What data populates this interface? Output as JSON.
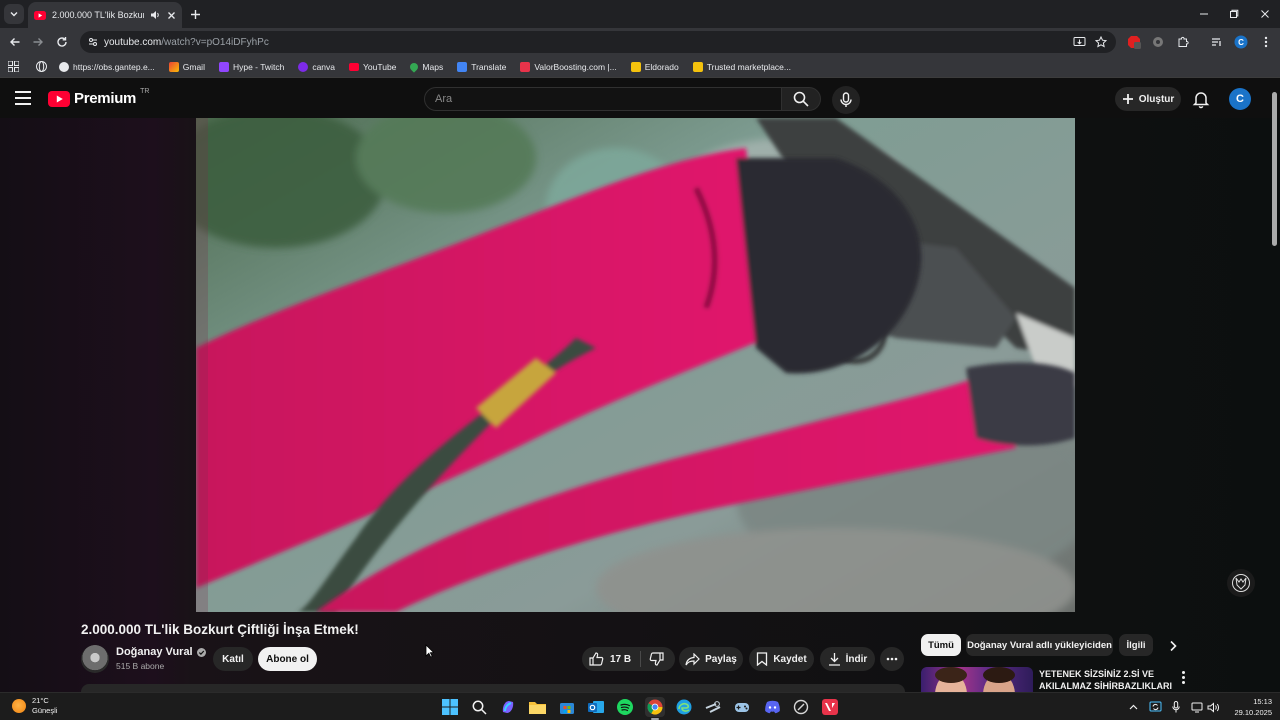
{
  "browser": {
    "tab": {
      "title": "2.000.000 TL'lik Bozkurt Çiftli"
    },
    "url": {
      "host": "youtube.com",
      "path": "/watch?v=pO14iDFyhPc"
    },
    "bookmarks": [
      {
        "label": "https://obs.gantep.e...",
        "color": "#9aa0a6"
      },
      {
        "label": "Gmail",
        "color": "#9aa0a6"
      },
      {
        "label": "Hype - Twitch",
        "color": "#9146ff"
      },
      {
        "label": "canva",
        "color": "#7d2ae8"
      },
      {
        "label": "YouTube",
        "color": "#ff0033"
      },
      {
        "label": "Maps",
        "color": "#34a853"
      },
      {
        "label": "Translate",
        "color": "#4285f4"
      },
      {
        "label": "ValorBoosting.com |...",
        "color": "#e8334a"
      },
      {
        "label": "Eldorado",
        "color": "#f4c20d"
      },
      {
        "label": "Trusted marketplace...",
        "color": "#f4c20d"
      }
    ]
  },
  "youtube": {
    "logo_text": "Premium",
    "country_code": "TR",
    "search_placeholder": "Ara",
    "create_label": "Oluştur",
    "avatar_letter": "C"
  },
  "video": {
    "title": "2.000.000 TL'lik Bozkurt Çiftliği İnşa Etmek!",
    "channel": "Doğanay Vural",
    "subscribers": "515 B abone",
    "join_label": "Katıl",
    "subscribe_label": "Abone ol",
    "likes": "17 B",
    "share_label": "Paylaş",
    "save_label": "Kaydet",
    "download_label": "İndir"
  },
  "sidebar": {
    "chips": [
      "Tümü",
      "Doğanay Vural adlı yükleyiciden",
      "İlgili"
    ],
    "recommendation_title": "YETENEK SİZSİNİZ 2.Sİ VE AKILALMAZ SİHİRBAZLIKLARI"
  },
  "taskbar": {
    "weather_temp": "21°C",
    "weather_desc": "Güneşli",
    "time": "15:13",
    "date": "29.10.2025"
  },
  "colors": {
    "youtube_red": "#ff0033",
    "accent_blue": "#1a73c8",
    "dark_bg": "#0f0f0f"
  }
}
